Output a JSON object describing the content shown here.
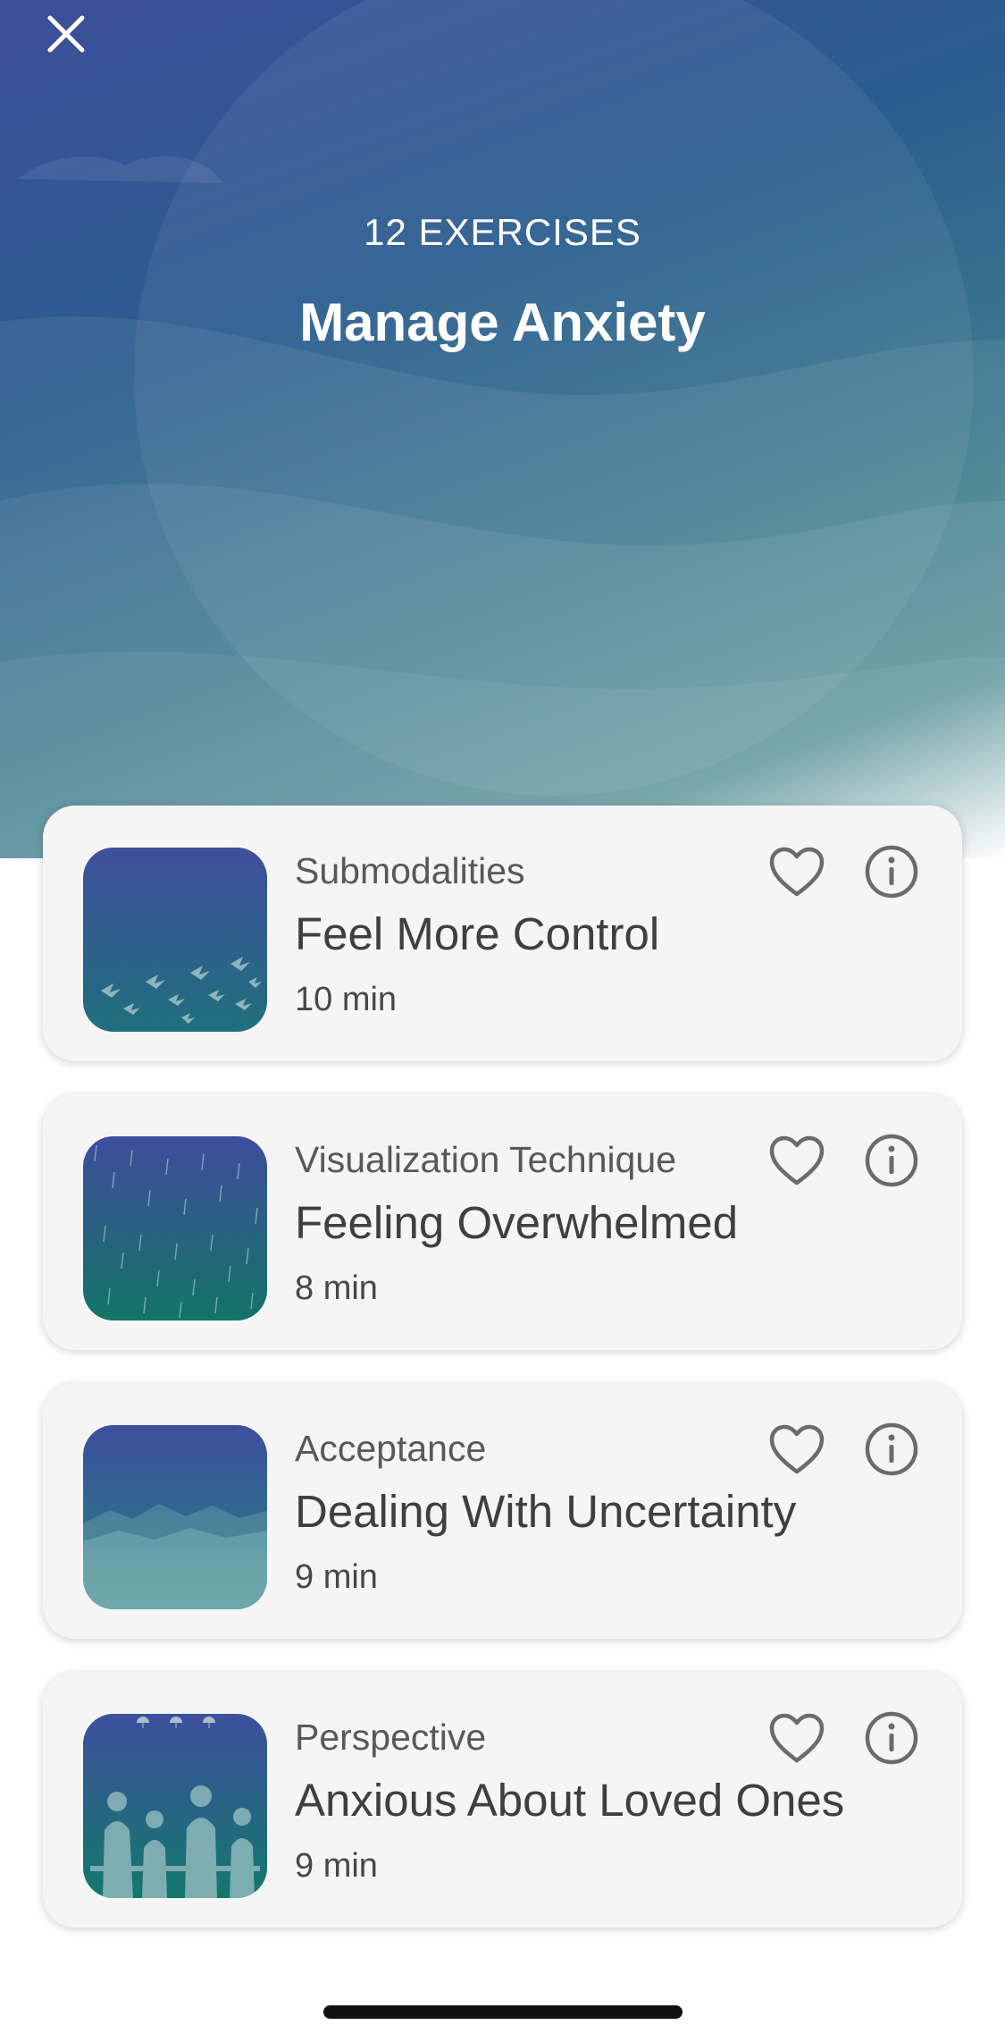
{
  "header": {
    "close_icon": "close-icon",
    "subtitle": "12 EXERCISES",
    "title": "Manage Anxiety"
  },
  "exercises": [
    {
      "category": "Submodalities",
      "title": "Feel More Control",
      "duration": "10 min",
      "thumbnail": "birds-flock"
    },
    {
      "category": "Visualization Technique",
      "title": "Feeling Overwhelmed",
      "duration": "8 min",
      "thumbnail": "rain"
    },
    {
      "category": "Acceptance",
      "title": "Dealing With Uncertainty",
      "duration": "9 min",
      "thumbnail": "misty-mountains"
    },
    {
      "category": "Perspective",
      "title": "Anxious About Loved Ones",
      "duration": "9 min",
      "thumbnail": "family-silhouette"
    }
  ],
  "icons": {
    "favorite": "heart-icon",
    "info": "info-icon"
  },
  "colors": {
    "hero_top": "#3d4f9a",
    "hero_bottom": "#5b949a",
    "card_bg": "#f5f5f5",
    "icon_gray": "#6b6b6b"
  }
}
